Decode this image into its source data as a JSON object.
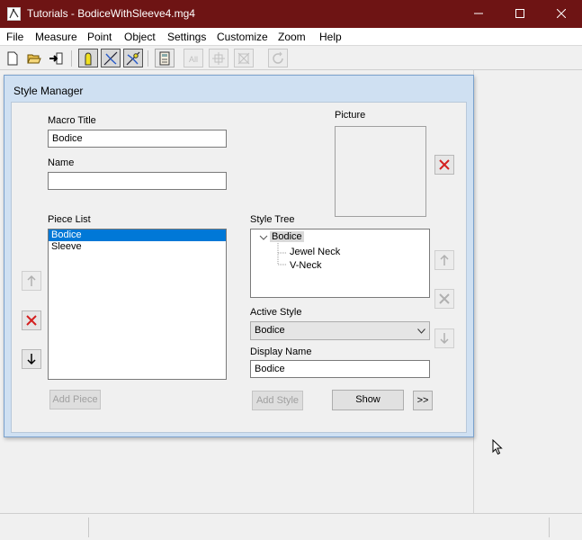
{
  "window": {
    "title": "Tutorials - BodiceWithSleeve4.mg4",
    "controls": [
      "minimize-icon",
      "maximize-icon",
      "close-icon"
    ]
  },
  "menu": {
    "items": [
      "File",
      "Measure",
      "Point",
      "Object",
      "Settings",
      "Customize",
      "Zoom",
      "Help"
    ]
  },
  "toolbar": {
    "buttons": [
      {
        "icon": "new-file-icon",
        "enabled": true
      },
      {
        "icon": "open-folder-icon",
        "enabled": true
      },
      {
        "icon": "import-icon",
        "enabled": true
      },
      {
        "icon": "figure-icon",
        "enabled": true,
        "active": true
      },
      {
        "icon": "measure-line-icon",
        "enabled": true,
        "active": true
      },
      {
        "icon": "edit-curve-icon",
        "enabled": true,
        "active": true
      },
      {
        "icon": "calculator-icon",
        "enabled": true
      },
      {
        "icon": "all-icon",
        "enabled": false
      },
      {
        "icon": "fit-icon",
        "enabled": false
      },
      {
        "icon": "expand-icon",
        "enabled": false
      },
      {
        "icon": "refresh-icon",
        "enabled": false
      }
    ]
  },
  "dialog": {
    "title": "Style Manager",
    "macro_title_label": "Macro Title",
    "macro_title_value": "Bodice",
    "name_label": "Name",
    "name_value": "",
    "picture_label": "Picture",
    "piece_list_label": "Piece List",
    "piece_list": [
      "Bodice",
      "Sleeve"
    ],
    "piece_list_selected": "Bodice",
    "add_piece_label": "Add Piece",
    "style_tree_label": "Style Tree",
    "style_tree": {
      "root": "Bodice",
      "children": [
        "Jewel Neck",
        "V-Neck"
      ]
    },
    "active_style_label": "Active Style",
    "active_style_value": "Bodice",
    "display_name_label": "Display Name",
    "display_name_value": "Bodice",
    "add_style_label": "Add Style",
    "show_label": "Show",
    "more_label": ">>",
    "colors": {
      "delete_red": "#d42020",
      "selection_blue": "#0078d7",
      "titlebar": "#6e1414"
    }
  }
}
